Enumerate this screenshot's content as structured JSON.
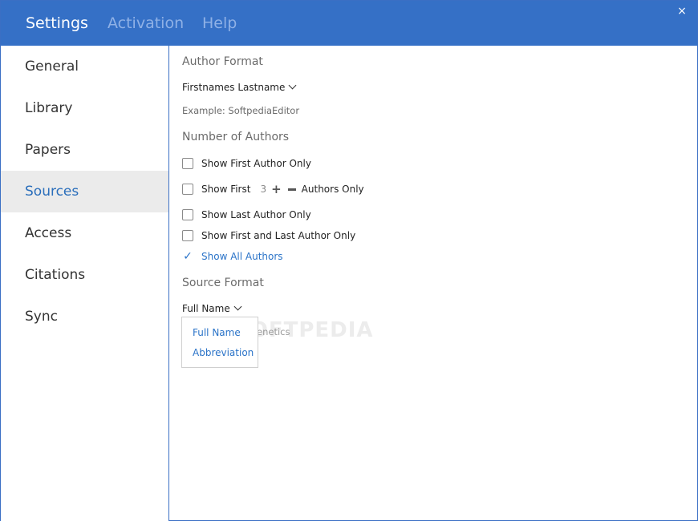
{
  "titlebar": {
    "tabs": [
      {
        "label": "Settings",
        "active": true
      },
      {
        "label": "Activation",
        "active": false
      },
      {
        "label": "Help",
        "active": false
      }
    ],
    "close_icon": "×"
  },
  "sidebar": {
    "items": [
      {
        "label": "General",
        "selected": false
      },
      {
        "label": "Library",
        "selected": false
      },
      {
        "label": "Papers",
        "selected": false
      },
      {
        "label": "Sources",
        "selected": true
      },
      {
        "label": "Access",
        "selected": false
      },
      {
        "label": "Citations",
        "selected": false
      },
      {
        "label": "Sync",
        "selected": false
      }
    ]
  },
  "content": {
    "author_format": {
      "heading": "Author Format",
      "selected": "Firstnames Lastname",
      "example": "Example: SoftpediaEditor"
    },
    "number_of_authors": {
      "heading": "Number of Authors",
      "options": {
        "first_only": "Show First Author Only",
        "show_first": "Show First",
        "count": "3",
        "authors_only": "Authors Only",
        "last_only": "Show Last Author Only",
        "first_and_last": "Show First and Last Author Only",
        "all_authors": "Show All Authors"
      },
      "checked": "all_authors"
    },
    "source_format": {
      "heading": "Source Format",
      "selected": "Full Name",
      "partial_text": "enetics",
      "popup_options": [
        "Full Name",
        "Abbreviation"
      ]
    },
    "watermark": "SOFTPEDIA"
  },
  "colors": {
    "titlebar": "#3570c6",
    "accent": "#2a73c8",
    "selected_bg": "#ebebeb"
  }
}
